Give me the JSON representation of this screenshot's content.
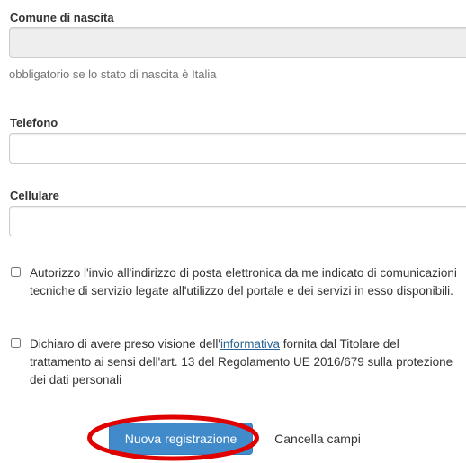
{
  "form": {
    "comune_label": "Comune di nascita",
    "comune_value": "",
    "comune_help": "obbligatorio se lo stato di nascita è Italia",
    "telefono_label": "Telefono",
    "telefono_value": "",
    "cellulare_label": "Cellulare",
    "cellulare_value": "",
    "consent_email_text": "Autorizzo l'invio all'indirizzo di posta elettronica da me indicato di comunicazioni tecniche di servizio legate all'utilizzo del portale e dei servizi in esso disponibili.",
    "consent_email_checked": false,
    "privacy_text_before": "Dichiaro di avere preso visione dell'",
    "privacy_link": "informativa",
    "privacy_text_after": " fornita dal Titolare del trattamento ai sensi dell'art. 13 del Regolamento UE 2016/679 sulla protezione dei dati personali",
    "privacy_checked": false
  },
  "actions": {
    "submit_label": "Nuova registrazione",
    "reset_label": "Cancella campi"
  },
  "colors": {
    "primary": "#428bca",
    "annotation": "#e00000",
    "link": "#2a6496"
  }
}
